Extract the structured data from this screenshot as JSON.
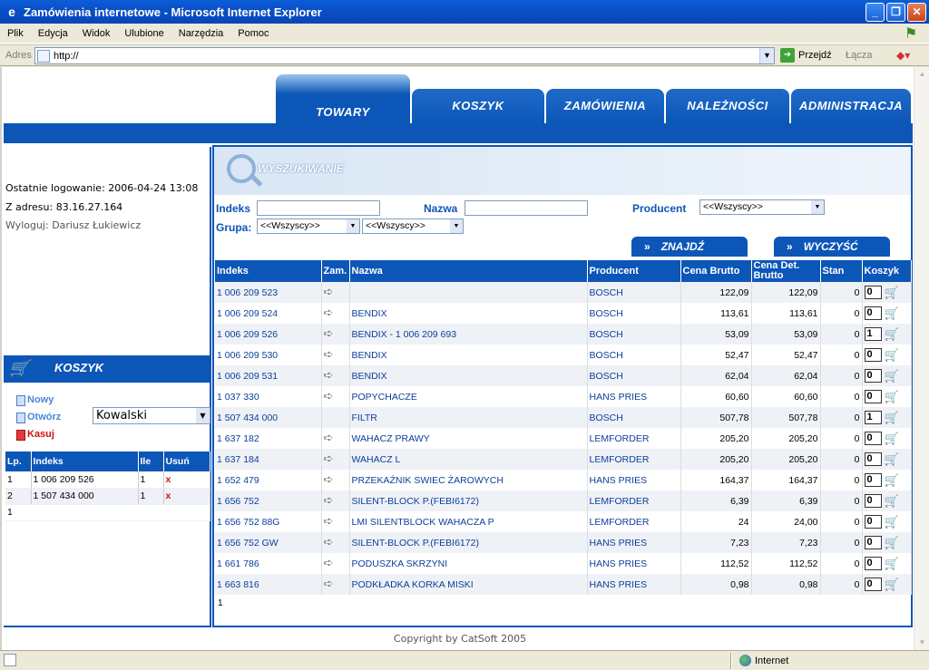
{
  "window": {
    "title": "Zamówienia internetowe - Microsoft Internet Explorer"
  },
  "menu": [
    "Plik",
    "Edycja",
    "Widok",
    "Ulubione",
    "Narzędzia",
    "Pomoc"
  ],
  "address": {
    "label": "Adres",
    "value": "http://",
    "go": "Przejdź",
    "links": "Łącza"
  },
  "status": {
    "zone": "Internet"
  },
  "tabs": [
    "TOWARY",
    "KOSZYK",
    "ZAMÓWIENIA",
    "NALEŻNOŚCI",
    "ADMINISTRACJA"
  ],
  "login": {
    "last": "Ostatnie logowanie: 2006-04-24 13:08",
    "ip": "Z adresu: 83.16.27.164",
    "logout": "Wyloguj: Dariusz Łukiewicz"
  },
  "basket": {
    "title": "KOSZYK",
    "new": "Nowy",
    "open": "Otwórz",
    "delete": "Kasuj",
    "customer": "Kowalski",
    "headers": [
      "Lp.",
      "Indeks",
      "Ile",
      "Usuń"
    ],
    "rows": [
      {
        "lp": "1",
        "idx": "1 006 209 526",
        "qty": "1",
        "del": "x"
      },
      {
        "lp": "2",
        "idx": "1 507 434 000",
        "qty": "1",
        "del": "x"
      }
    ],
    "page": "1"
  },
  "search": {
    "title": "WYSZUKIWANIE",
    "index_label": "Indeks",
    "name_label": "Nazwa",
    "producer_label": "Producent",
    "producer_value": "<<Wszyscy>>",
    "group_label": "Grupa:",
    "group1": "<<Wszyscy>>",
    "group2": "<<Wszyscy>>",
    "find": "ZNAJDŹ",
    "clear": "WYCZYŚĆ"
  },
  "grid": {
    "headers": [
      "Indeks",
      "Zam.",
      "Nazwa",
      "Producent",
      "Cena Brutto",
      "Cena Det. Brutto",
      "Stan",
      "Koszyk"
    ],
    "rows": [
      {
        "idx": "1 006 209 523",
        "arrow": true,
        "name": "",
        "prod": "BOSCH",
        "price": "122,09",
        "det": "122,09",
        "stock": "0",
        "qty": "0"
      },
      {
        "idx": "1 006 209 524",
        "arrow": true,
        "name": "BENDIX",
        "prod": "BOSCH",
        "price": "113,61",
        "det": "113,61",
        "stock": "0",
        "qty": "0"
      },
      {
        "idx": "1 006 209 526",
        "arrow": true,
        "name": "BENDIX - 1 006 209 693",
        "prod": "BOSCH",
        "price": "53,09",
        "det": "53,09",
        "stock": "0",
        "qty": "1"
      },
      {
        "idx": "1 006 209 530",
        "arrow": true,
        "name": "BENDIX",
        "prod": "BOSCH",
        "price": "52,47",
        "det": "52,47",
        "stock": "0",
        "qty": "0"
      },
      {
        "idx": "1 006 209 531",
        "arrow": true,
        "name": "BENDIX",
        "prod": "BOSCH",
        "price": "62,04",
        "det": "62,04",
        "stock": "0",
        "qty": "0"
      },
      {
        "idx": "1 037 330",
        "arrow": true,
        "name": "POPYCHACZE",
        "prod": "HANS PRIES",
        "price": "60,60",
        "det": "60,60",
        "stock": "0",
        "qty": "0"
      },
      {
        "idx": "1 507 434 000",
        "arrow": false,
        "name": "FILTR",
        "prod": "BOSCH",
        "price": "507,78",
        "det": "507,78",
        "stock": "0",
        "qty": "1"
      },
      {
        "idx": "1 637 182",
        "arrow": true,
        "name": "WAHACZ PRAWY",
        "prod": "LEMFORDER",
        "price": "205,20",
        "det": "205,20",
        "stock": "0",
        "qty": "0"
      },
      {
        "idx": "1 637 184",
        "arrow": true,
        "name": "WAHACZ L",
        "prod": "LEMFORDER",
        "price": "205,20",
        "det": "205,20",
        "stock": "0",
        "qty": "0"
      },
      {
        "idx": "1 652 479",
        "arrow": true,
        "name": "PRZEKAŹNIK SWIEC ŻAROWYCH",
        "prod": "HANS PRIES",
        "price": "164,37",
        "det": "164,37",
        "stock": "0",
        "qty": "0"
      },
      {
        "idx": "1 656 752",
        "arrow": true,
        "name": "SILENT-BLOCK P.(FEBI6172)",
        "prod": "LEMFORDER",
        "price": "6,39",
        "det": "6,39",
        "stock": "0",
        "qty": "0"
      },
      {
        "idx": "1 656 752 88G",
        "arrow": true,
        "name": "LMI SILENTBLOCK WAHACZA P",
        "prod": "LEMFORDER",
        "price": "24",
        "det": "24,00",
        "stock": "0",
        "qty": "0"
      },
      {
        "idx": "1 656 752 GW",
        "arrow": true,
        "name": "SILENT-BLOCK P.(FEBI6172)",
        "prod": "HANS PRIES",
        "price": "7,23",
        "det": "7,23",
        "stock": "0",
        "qty": "0"
      },
      {
        "idx": "1 661 786",
        "arrow": true,
        "name": "PODUSZKA SKRZYNI",
        "prod": "HANS PRIES",
        "price": "112,52",
        "det": "112,52",
        "stock": "0",
        "qty": "0"
      },
      {
        "idx": "1 663 816",
        "arrow": true,
        "name": "PODKŁADKA KORKA MISKI",
        "prod": "HANS PRIES",
        "price": "0,98",
        "det": "0,98",
        "stock": "0",
        "qty": "0"
      }
    ],
    "page": "1"
  },
  "footer": {
    "copyright": "Copyright by CatSoft 2005"
  }
}
